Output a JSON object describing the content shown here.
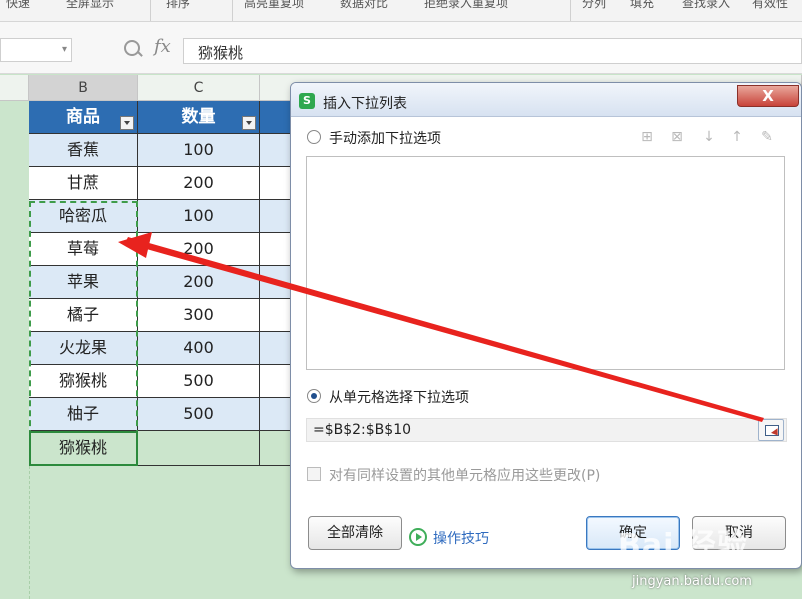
{
  "ribbon": {
    "items": [
      "快速",
      "全屏显示",
      "排序",
      "高亮重复项",
      "数据对比",
      "拒绝录入重复项",
      "分列",
      "填充",
      "查找录入",
      "有效性"
    ]
  },
  "formula_bar": {
    "fx_label": "fx",
    "value": "猕猴桃"
  },
  "sheet": {
    "columns": [
      "B",
      "C"
    ],
    "headers": [
      "商品",
      "数量"
    ],
    "rows": [
      {
        "product": "香蕉",
        "qty": "100"
      },
      {
        "product": "甘蔗",
        "qty": "200"
      },
      {
        "product": "哈密瓜",
        "qty": "100"
      },
      {
        "product": "草莓",
        "qty": "200"
      },
      {
        "product": "苹果",
        "qty": "200"
      },
      {
        "product": "橘子",
        "qty": "300"
      },
      {
        "product": "火龙果",
        "qty": "400"
      },
      {
        "product": "猕猴桃",
        "qty": "500"
      },
      {
        "product": "柚子",
        "qty": "500"
      },
      {
        "product": "猕猴桃",
        "qty": ""
      }
    ]
  },
  "dialog": {
    "icon_letter": "S",
    "title": "插入下拉列表",
    "close_label": "X",
    "manual_option": "手动添加下拉选项",
    "cell_option": "从单元格选择下拉选项",
    "range_value": "=$B$2:$B$10",
    "apply_checkbox": "对有同样设置的其他单元格应用这些更改(P)",
    "clear_button": "全部清除",
    "tips_link": "操作技巧",
    "ok_button": "确定",
    "cancel_button": "取消"
  },
  "watermark": {
    "logo": "Bai 经验",
    "url": "jingyan.baidu.com"
  },
  "colors": {
    "header_blue": "#2d6db2",
    "arrow_red": "#e8231e",
    "sheet_green": "#cbe5cc"
  }
}
